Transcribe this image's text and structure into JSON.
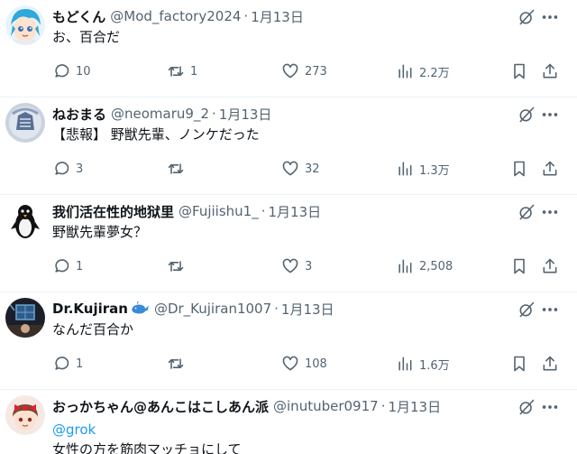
{
  "tweets": [
    {
      "name": "もどくん",
      "handle": "@Mod_factory2024",
      "date": "1月13日",
      "mention": "",
      "text": "お、百合だ",
      "reply_count": "10",
      "retweet_count": "1",
      "like_count": "273",
      "view_count": "2.2万",
      "avatar_icon": "anime-blue-hair-avatar"
    },
    {
      "name": "ねおまる",
      "handle": "@neomaru9_2",
      "date": "1月13日",
      "mention": "",
      "text": "【悲報】 野獣先輩、ノンケだった",
      "reply_count": "3",
      "retweet_count": "",
      "like_count": "32",
      "view_count": "1.3万",
      "avatar_icon": "blue-emblem-avatar"
    },
    {
      "name": "我们活在性的地狱里",
      "handle": "@Fujiishu1_",
      "date": "1月13日",
      "mention": "",
      "text": "野獣先輩夢女？",
      "reply_count": "1",
      "retweet_count": "",
      "like_count": "3",
      "view_count": "2,508",
      "avatar_icon": "penguin-avatar"
    },
    {
      "name": "Dr.Kujiran",
      "handle": "@Dr_Kujiran1007",
      "date": "1月13日",
      "mention": "",
      "text": "なんだ百合か",
      "reply_count": "1",
      "retweet_count": "",
      "like_count": "108",
      "view_count": "1.6万",
      "avatar_icon": "dark-room-avatar",
      "name_badge_icon": "whale-icon"
    },
    {
      "name": "おっかちゃん@あんこはこしあん派",
      "handle": "@inutuber0917",
      "date": "1月13日",
      "mention": "@grok",
      "text": "女性の方を筋肉マッチョにして",
      "avatar_icon": "red-ribbon-girl-avatar"
    }
  ],
  "separator": "·",
  "colors": {
    "text": "#0f1419",
    "muted": "#536471",
    "link": "#1d9bf0",
    "border": "#eff3f4"
  }
}
